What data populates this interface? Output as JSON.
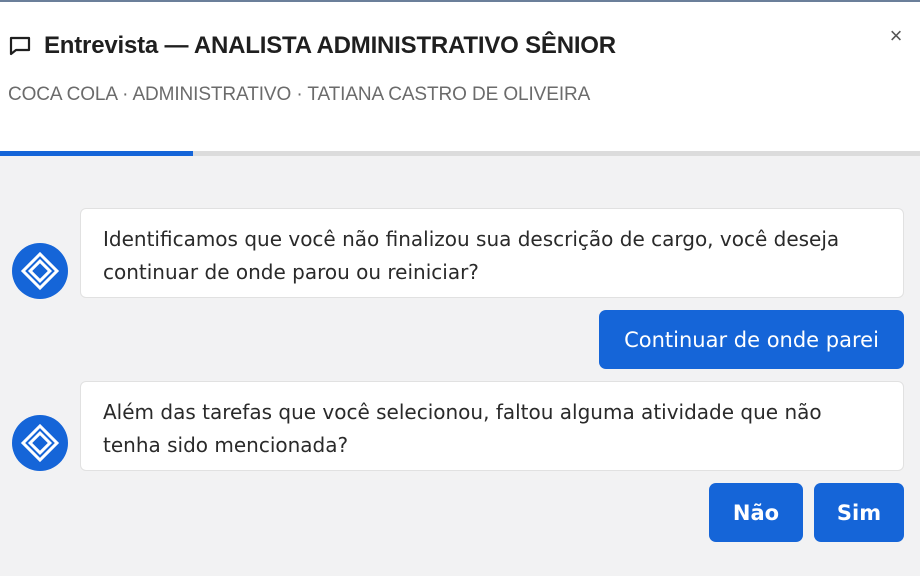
{
  "header": {
    "title": "Entrevista — ANALISTA ADMINISTRATIVO SÊNIOR",
    "subtitle": "COCA COLA · ADMINISTRATIVO · TATIANA CASTRO DE OLIVEIRA",
    "close_symbol": "×",
    "progress_fraction": 0.21
  },
  "messages": [
    {
      "text": "Identificamos que você não finalizou sua descrição de cargo, você deseja continuar de onde parou ou reiniciar?"
    },
    {
      "text": "Além das tarefas que você selecionou, faltou alguma atividade que não tenha sido mencionada?"
    }
  ],
  "responses": {
    "continue_label": "Continuar de onde parei",
    "no_label": "Não",
    "yes_label": "Sim"
  },
  "colors": {
    "accent": "#1565d8",
    "background": "#f2f2f3"
  },
  "icons": {
    "title": "chat-bubble-icon",
    "avatar": "diamond-logo-icon",
    "close": "close-icon"
  }
}
